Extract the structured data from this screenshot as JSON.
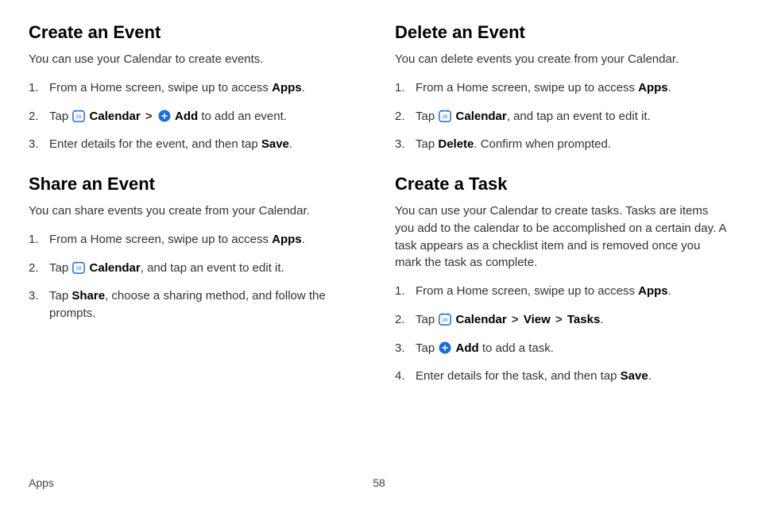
{
  "footer": {
    "section_label": "Apps",
    "page_number": "58"
  },
  "sections": {
    "create_event": {
      "heading": "Create an Event",
      "intro": "You can use your Calendar to create events.",
      "steps": {
        "s1_a": "From a Home screen, swipe up to access ",
        "s1_b": "Apps",
        "s1_c": ".",
        "s2_a": "Tap ",
        "s2_cal": "Calendar",
        "s2_gt": ">",
        "s2_add": "Add",
        "s2_b": " to add an event.",
        "s3_a": "Enter details for the event, and then tap ",
        "s3_b": "Save",
        "s3_c": "."
      }
    },
    "share_event": {
      "heading": "Share an Event",
      "intro": "You can share events you create from your Calendar.",
      "steps": {
        "s1_a": "From a Home screen, swipe up to access ",
        "s1_b": "Apps",
        "s1_c": ".",
        "s2_a": "Tap ",
        "s2_cal": "Calendar",
        "s2_b": ", and tap an event to edit it.",
        "s3_a": "Tap ",
        "s3_b": "Share",
        "s3_c": ", choose a sharing method, and follow the prompts."
      }
    },
    "delete_event": {
      "heading": "Delete an Event",
      "intro": "You can delete events you create from your Calendar.",
      "steps": {
        "s1_a": "From a Home screen, swipe up to access ",
        "s1_b": "Apps",
        "s1_c": ".",
        "s2_a": "Tap ",
        "s2_cal": "Calendar",
        "s2_b": ", and tap an event to edit it.",
        "s3_a": "Tap ",
        "s3_b": "Delete",
        "s3_c": ". Confirm when prompted."
      }
    },
    "create_task": {
      "heading": "Create a Task",
      "intro": "You can use your Calendar to create tasks. Tasks are items you add to the calendar to be accomplished on a certain day. A task appears as a checklist item and is removed once you mark the task as complete.",
      "steps": {
        "s1_a": "From a Home screen, swipe up to access ",
        "s1_b": "Apps",
        "s1_c": ".",
        "s2_a": "Tap ",
        "s2_cal": "Calendar",
        "s2_gt": ">",
        "s2_view": "View",
        "s2_tasks": "Tasks",
        "s2_end": ".",
        "s3_a": "Tap ",
        "s3_add": "Add",
        "s3_b": " to add a task.",
        "s4_a": "Enter details for the task, and then tap ",
        "s4_b": "Save",
        "s4_c": "."
      }
    }
  }
}
